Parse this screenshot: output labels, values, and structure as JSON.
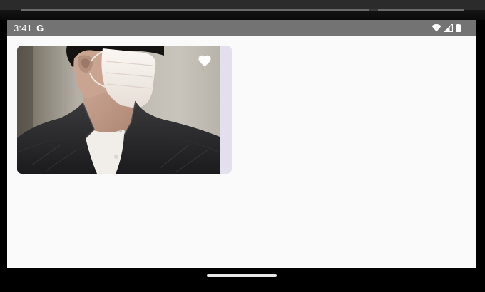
{
  "status_bar": {
    "time": "3:41",
    "notification_icon": "google-g-icon",
    "icons": [
      "wifi-icon",
      "cell-signal-icon",
      "battery-icon"
    ]
  },
  "gallery": {
    "items": [
      {
        "image": "photo-person-wearing-white-face-mask-dark-denim-shirt",
        "favorite": true,
        "favorite_icon": "heart-icon"
      }
    ]
  },
  "colors": {
    "status_bar_bg": "#737373",
    "screen_bg": "#fafafa",
    "card_bg": "#e4dfec",
    "favorite_icon": "#ffffff",
    "bezel": "#000000"
  }
}
